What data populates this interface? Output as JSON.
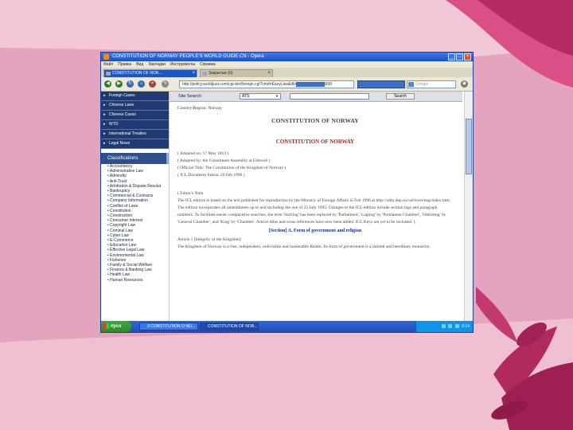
{
  "window": {
    "title": "CONSTITUTION OF NORWAY PEOPLE'S WORLD GUIDE.CN - Opera"
  },
  "menu": [
    "Файл",
    "Правка",
    "Вид",
    "Закладки",
    "Инструменты",
    "Справка"
  ],
  "tabs": [
    {
      "label": "CONSTITUTION OF NOR..."
    },
    {
      "label": "Закрытые (0)"
    }
  ],
  "address": {
    "url": "http://policy.worldjust.com/cgi-bin/foreign.cgi?cmd=EasyLaw&db=Law&id=8&id=8658"
  },
  "search_engine": {
    "placeholder": "Google"
  },
  "sidebar": {
    "nav": [
      "Foreign Cases",
      "Chinese Laws",
      "Chinese Cases",
      "WTO",
      "International Treaties",
      "Legal News"
    ],
    "classifications_title": "Classifications",
    "classifications": [
      "Accountancy",
      "Administrative Law",
      "Admiralty",
      "Anti-Trust",
      "Arbitration & Dispute Resolut",
      "Bankruptcy",
      "Commercial & Contracts",
      "Company Information",
      "Conflict of Laws",
      "Constitution",
      "Construction",
      "Consumer Interest",
      "Copyright Law",
      "Criminal Law",
      "Cyber Law",
      "E-Commerce",
      "Education Law",
      "Effective Legal Law",
      "Environmental Law",
      "Fisheries",
      "Family & Social Welfare",
      "Finance & Banking Law",
      "Health Law",
      "Human Resources"
    ]
  },
  "search": {
    "label": "Site Search:",
    "scope": "ATS",
    "button": "Search"
  },
  "doc": {
    "country": "Country/Region: Norway",
    "title_black": "CONSTITUTION OF NORWAY",
    "title_red": "CONSTITUTION OF NORWAY",
    "meta": [
      "( Adopted on: 17 May 1814 )",
      "( Adopted by: the Constituent Assembly at Eidsvoll )",
      "( Official Title: The Constitution of the Kingdom of Norway )",
      "( ICL Document Status: 29 Feb 1996 )"
    ],
    "note_head": "( Editor's Note",
    "note_body": "The ICL edition is based on the text published for reproduction by the Ministry of Foreign Affairs in Feb 1996 at http://odin.dep.no/ud/lover/eng/index.htm. The edition incorporates all amendments up to and including the one of 25 July 1995. Changes to the ICL edition include section tags and paragraph numbers. To facilitate easier comparative searches, the term 'Storting' has been replaced by 'Parliament', 'Lagting' by 'Permanent Chamber', 'Odelsting' by 'General Chamber', and 'King' by 'Chamber'. Article titles and cross references have now been added. ICL Keys are yet to be included. )",
    "section_head": "[Section] A. Form of government and religion",
    "article_head": "Article 1 [Integrity of the Kingdom]",
    "article_body": "The Kingdom of Norway is a free, independent, indivisible and inalienable Realm. Its form of government is a limited and hereditary monarchy."
  },
  "taskbar": {
    "start": "пуск",
    "tasks": [
      "3 CONSTITUTION O NO...",
      "CONSTITUTION OF NOR..."
    ],
    "clock": "0:14"
  },
  "colors": {
    "brand_pink": "#e9a9c0",
    "accent_red": "#c71a1a",
    "nav_blue": "#1f3a73"
  }
}
